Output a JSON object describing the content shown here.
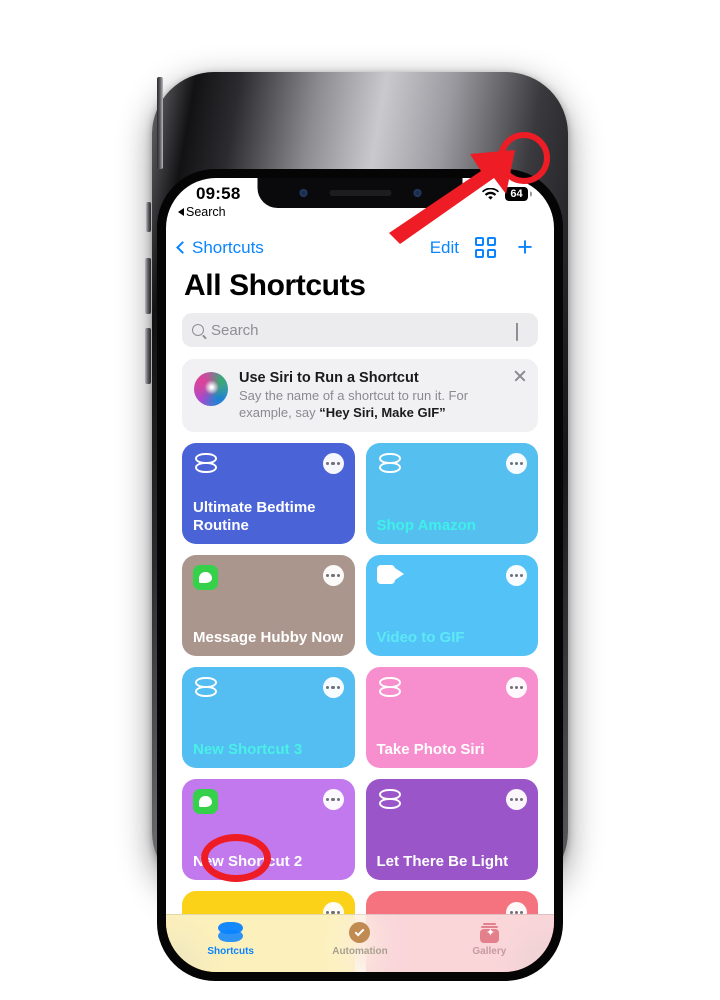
{
  "status_bar": {
    "time": "09:58",
    "back_to_app": "Search",
    "wifi_icon": "wifi-icon",
    "battery_percent": "64"
  },
  "nav_bar": {
    "back_label": "Shortcuts",
    "back_icon": "chevron-left-icon",
    "edit_label": "Edit",
    "grid_icon": "grid-view-icon",
    "add_icon": "plus-icon"
  },
  "page": {
    "title": "All Shortcuts"
  },
  "search": {
    "placeholder": "Search",
    "value": "",
    "icon": "search-icon",
    "mic_icon": "microphone-icon"
  },
  "siri_banner": {
    "icon": "siri-orb-icon",
    "title": "Use Siri to Run a Shortcut",
    "subtitle_prefix": "Say the name of a shortcut to run it. For example, say ",
    "subtitle_quote": "“Hey Siri, Make GIF”",
    "close_icon": "close-icon"
  },
  "shortcuts": [
    {
      "name": "Ultimate Bedtime Routine",
      "color": "#4a64d8",
      "glyph": "stack-icon",
      "text_color": "#ffffff",
      "more_icon": "more-options-icon"
    },
    {
      "name": "Shop Amazon",
      "color": "#55c0f0",
      "glyph": "stack-icon",
      "text_color": "#3ef0e8",
      "more_icon": "more-options-icon"
    },
    {
      "name": "Message Hubby Now",
      "color": "#ab968d",
      "glyph": "message-icon",
      "text_color": "#ffffff",
      "more_icon": "more-options-icon"
    },
    {
      "name": "Video to GIF",
      "color": "#53c3f7",
      "glyph": "video-icon",
      "text_color": "#5ee8f5",
      "more_icon": "more-options-icon"
    },
    {
      "name": "New Shortcut 3",
      "color": "#54bdf2",
      "glyph": "stack-icon",
      "text_color": "#49f0e6",
      "more_icon": "more-options-icon"
    },
    {
      "name": "Take Photo Siri",
      "color": "#f78fce",
      "glyph": "stack-icon",
      "text_color": "#ffffff",
      "more_icon": "more-options-icon"
    },
    {
      "name": "New Shortcut 2",
      "color": "#c279ee",
      "glyph": "message-icon",
      "text_color": "#ffffff",
      "more_icon": "more-options-icon"
    },
    {
      "name": "Let There Be Light",
      "color": "#9a56c9",
      "glyph": "stack-icon",
      "text_color": "#ffffff",
      "more_icon": "more-options-icon"
    }
  ],
  "shortcuts_partial": [
    {
      "color": "#fbd217",
      "more_icon": "more-options-icon"
    },
    {
      "color": "#f4737f",
      "more_icon": "more-options-icon"
    }
  ],
  "tab_bar": {
    "items": [
      {
        "label": "Shortcuts",
        "icon": "shortcuts-stack-icon",
        "active": true
      },
      {
        "label": "Automation",
        "icon": "automation-check-icon",
        "active": false
      },
      {
        "label": "Gallery",
        "icon": "gallery-card-icon",
        "active": false
      }
    ]
  },
  "annotations": {
    "accent_color": "#ee1c24",
    "arrow": "red-arrow-pointing-to-add-button",
    "circle_add": "red-circle-highlight-add-button",
    "circle_tab": "red-circle-highlight-shortcuts-tab"
  }
}
